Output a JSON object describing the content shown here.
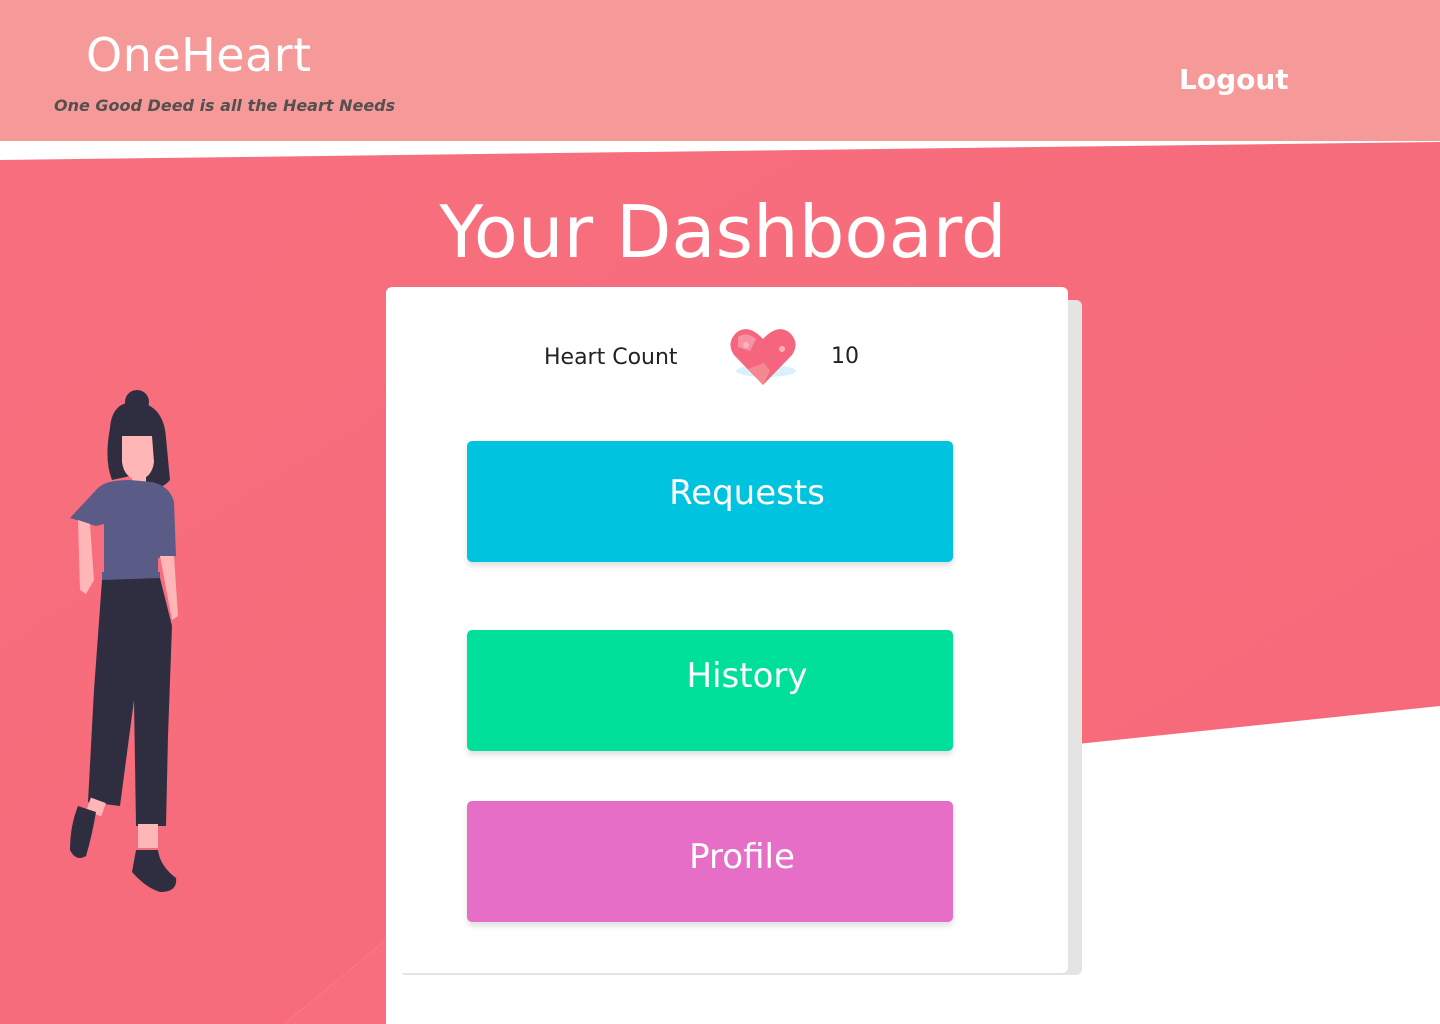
{
  "header": {
    "brand": "OneHeart",
    "tagline": "One Good Deed is all the Heart Needs",
    "logout_label": "Logout"
  },
  "main": {
    "title": "Your Dashboard",
    "heart_count_label": "Heart Count",
    "heart_count_value": "10",
    "buttons": {
      "requests": "Requests",
      "history": "History",
      "profile": "Profile"
    }
  },
  "icons": {
    "heart": "heart-icon",
    "figure": "woman-illustration"
  },
  "colors": {
    "header_bg": "#f59a98",
    "hero_bg": "#f76f7e",
    "requests": "#00c3e0",
    "history": "#00e09a",
    "profile": "#e66ec6"
  }
}
